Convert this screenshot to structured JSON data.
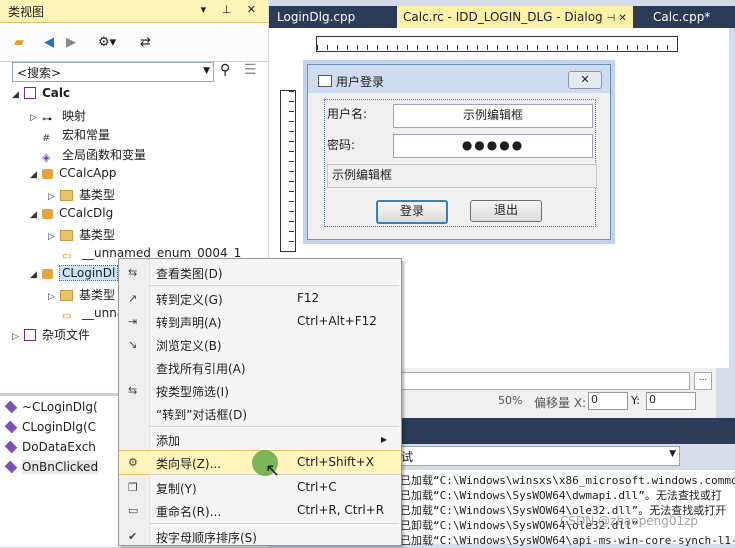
{
  "class_view": {
    "title": "类视图",
    "pin_buttons": "▾ ⊥ ✕",
    "search_placeholder": "<搜索>",
    "tree": [
      {
        "label": "Calc",
        "bold": true
      },
      {
        "label": "映射"
      },
      {
        "label": "宏和常量"
      },
      {
        "label": "全局函数和变量"
      },
      {
        "label": "CCalcApp"
      },
      {
        "label": "基类型"
      },
      {
        "label": "CCalcDlg"
      },
      {
        "label": "基类型"
      },
      {
        "label": "__unnamed_enum_0004_1"
      },
      {
        "label": "CLoginDl"
      },
      {
        "label": "基类型"
      },
      {
        "label": "__unna"
      },
      {
        "label": "杂项文件"
      }
    ],
    "members": [
      "~CLoginDlg(",
      "CLoginDlg(C",
      "DoDataExch",
      "OnBnClicked"
    ]
  },
  "tabs": [
    "LoginDlg.cpp",
    "Calc.rc - IDD_LOGIN_DLG - Dialog",
    "Calc.cpp*"
  ],
  "tab_pin": "⊣ ✕",
  "dialog": {
    "title": "用户登录",
    "close": "✕",
    "user_label": "用户名:",
    "user_value": "示例编辑框",
    "pwd_label": "密码:",
    "pwd_value": "●●●●●",
    "info_value": "示例编辑框",
    "login_button": "登录",
    "exit_button": "退出"
  },
  "props": {
    "zoom": "50%",
    "offset_label": "偏移量 X:",
    "x": "0",
    "y_label": "Y:",
    "y": "0"
  },
  "output": {
    "selector": "试",
    "lines": [
      "已加载“C:\\Windows\\winsxs\\x86_microsoft.windows.common",
      "已加载“C:\\Windows\\SysWOW64\\dwmapi.dll”。无法查找或打",
      "已加载“C:\\Windows\\SysWOW64\\ole32.dll”。无法查找或打开",
      "已卸载“C:\\Windows\\SysWOW64\\ole32.dll”",
      "已加载“C:\\Windows\\SysWOW64\\api-ms-win-core-synch-l1-2"
    ]
  },
  "context_menu": {
    "items": [
      {
        "label": "查看类图(D)",
        "key": ""
      },
      {
        "label": "转到定义(G)",
        "key": "F12"
      },
      {
        "label": "转到声明(A)",
        "key": "Ctrl+Alt+F12"
      },
      {
        "label": "浏览定义(B)",
        "key": ""
      },
      {
        "label": "查找所有引用(A)",
        "key": ""
      },
      {
        "label": "按类型筛选(I)",
        "key": ""
      },
      {
        "label": "“转到”对话框(D)",
        "key": ""
      },
      {
        "label": "添加",
        "key": "▸"
      },
      {
        "label": "类向导(Z)...",
        "key": "Ctrl+Shift+X"
      },
      {
        "label": "复制(Y)",
        "key": "Ctrl+C"
      },
      {
        "label": "重命名(R)...",
        "key": "Ctrl+R, Ctrl+R"
      },
      {
        "label": "按字母顺序排序(S)",
        "key": ""
      }
    ]
  },
  "watermark": "CSDN @zhaopeng01zp"
}
